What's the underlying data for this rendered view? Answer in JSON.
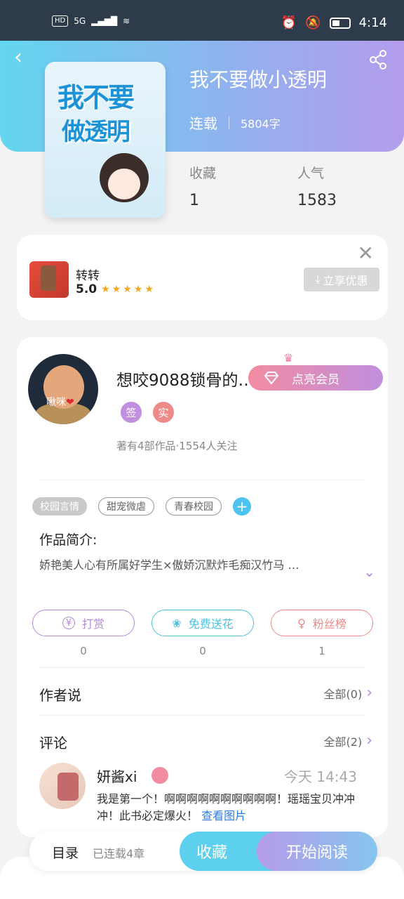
{
  "status_bar": {
    "network_left": [
      "HD",
      "5G"
    ],
    "time": "4:14"
  },
  "book": {
    "title": "我不要做小透明",
    "status": "连载",
    "words": "5804字",
    "cover_title_line1": "我不要",
    "cover_title_line2": "做透明"
  },
  "stats": {
    "favorites_label": "收藏",
    "favorites_value": "1",
    "popularity_label": "人气",
    "popularity_value": "1583"
  },
  "ad": {
    "name": "转转",
    "score": "5.0",
    "stars": "★★★★★",
    "button_label": "立享优惠"
  },
  "author": {
    "avatar_text": "啾咪",
    "name": "想咬9088锁骨的…",
    "badges": [
      "签",
      "实"
    ],
    "stats": "著有4部作品·1554人关注",
    "vip_button": "点亮会员"
  },
  "tags": [
    "校园言情",
    "甜宠微虐",
    "青春校园"
  ],
  "intro": {
    "title": "作品简介:",
    "text": "娇艳美人心有所属好学生×傲娇沉默炸毛痴汉竹马 …"
  },
  "actions": [
    {
      "label": "打赏",
      "count": "0",
      "color": "#b58ad9"
    },
    {
      "label": "免费送花",
      "count": "0",
      "color": "#4dc3e0"
    },
    {
      "label": "粉丝榜",
      "count": "1",
      "color": "#ef8a8a"
    }
  ],
  "author_says": {
    "title": "作者说",
    "more": "全部(0)"
  },
  "comments": {
    "title": "评论",
    "more": "全部(2)",
    "items": [
      {
        "user": "妍酱xi",
        "time": "今天 14:43",
        "text": "我是第一个！啊啊啊啊啊啊啊啊啊啊！瑶瑶宝贝冲冲冲！此书必定爆火！",
        "link": "查看图片"
      }
    ]
  },
  "bottom_bar": {
    "toc": "目录",
    "toc_status": "已连载4章",
    "favorite": "收藏",
    "start_reading": "开始阅读"
  }
}
